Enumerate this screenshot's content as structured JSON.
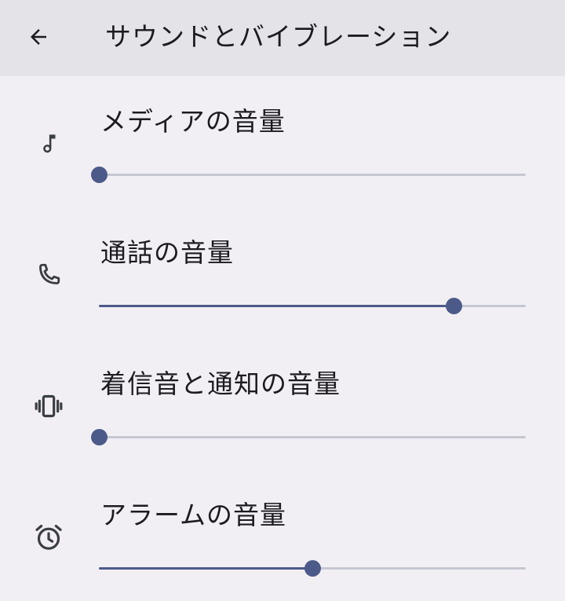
{
  "app_bar": {
    "title": "サウンドとバイブレーション",
    "back_icon": "arrow-back-icon"
  },
  "volume_rows": [
    {
      "label": "メディアの音量",
      "icon": "music-note-icon",
      "level": 0.0
    },
    {
      "label": "通話の音量",
      "icon": "phone-icon",
      "level": 0.83
    },
    {
      "label": "着信音と通知の音量",
      "icon": "vibrate-icon",
      "level": 0.0
    },
    {
      "label": "アラームの音量",
      "icon": "alarm-icon",
      "level": 0.5
    }
  ],
  "colors": {
    "accent": "#4c5a8a",
    "track_inactive": "#c5c7d1",
    "app_bar_bg": "#e3e3e8",
    "page_bg": "#f2eff4",
    "icon": "#3b3d44"
  }
}
